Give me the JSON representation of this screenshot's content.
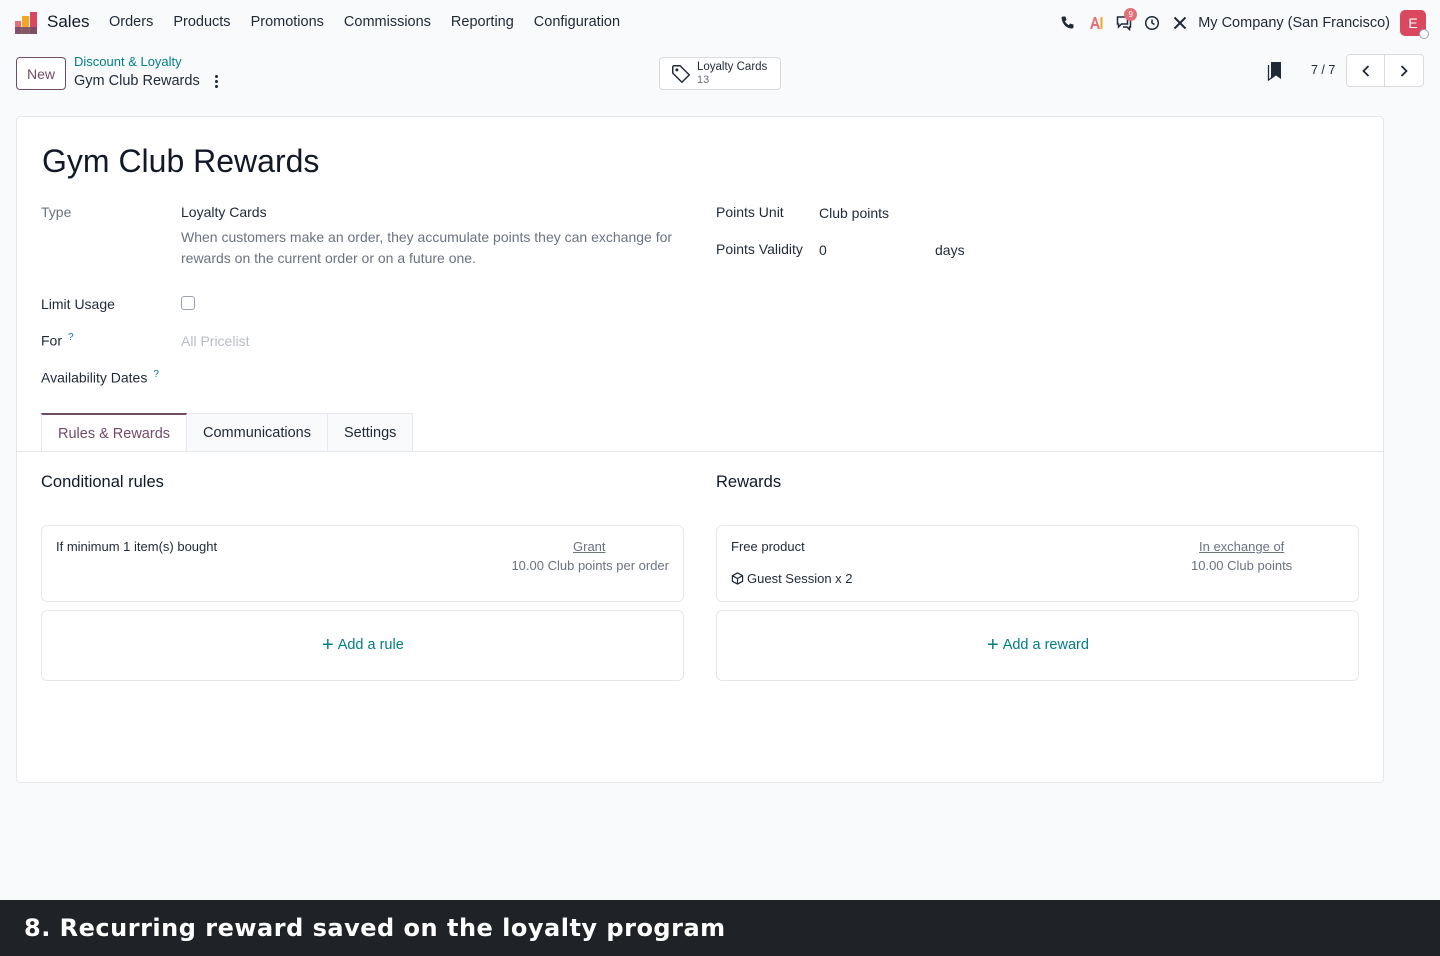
{
  "nav": {
    "app_name": "Sales",
    "menu": [
      "Orders",
      "Products",
      "Promotions",
      "Commissions",
      "Reporting",
      "Configuration"
    ],
    "messages_badge": "9",
    "company": "My Company (San Francisco)",
    "avatar_initial": "E"
  },
  "control_panel": {
    "new_label": "New",
    "breadcrumb_parent": "Discount & Loyalty",
    "breadcrumb_current": "Gym Club Rewards",
    "smart_button": {
      "label": "Loyalty Cards",
      "value": "13"
    },
    "pager": "7 / 7"
  },
  "form": {
    "title": "Gym Club Rewards",
    "type_label": "Type",
    "type_value": "Loyalty Cards",
    "type_description": "When customers make an order, they accumulate points they can exchange for rewards on the current order or on a future one.",
    "points_unit_label": "Points Unit",
    "points_unit_value": "Club points",
    "points_validity_label": "Points Validity",
    "points_validity_value": "0",
    "points_validity_unit": "days",
    "limit_usage_label": "Limit Usage",
    "for_label": "For",
    "for_placeholder": "All Pricelist",
    "availability_label": "Availability Dates",
    "help_mark": "?"
  },
  "tabs": [
    {
      "label": "Rules & Rewards",
      "active": true
    },
    {
      "label": "Communications",
      "active": false
    },
    {
      "label": "Settings",
      "active": false
    }
  ],
  "rules": {
    "title": "Conditional rules",
    "rule_text": "If minimum 1 item(s) bought",
    "grant_label": "Grant",
    "grant_value": "10.00 Club points per order",
    "add_label": "Add a rule"
  },
  "rewards": {
    "title": "Rewards",
    "reward_type": "Free product",
    "reward_product": "Guest Session x 2",
    "exchange_label": "In exchange of",
    "exchange_value": "10.00 Club points",
    "add_label": "Add a reward"
  },
  "caption": "8. Recurring reward saved on the loyalty program",
  "colors": {
    "brand": "#714b67",
    "link": "#017e84",
    "badge": "#e46f78",
    "avatar": "#d9485f"
  }
}
